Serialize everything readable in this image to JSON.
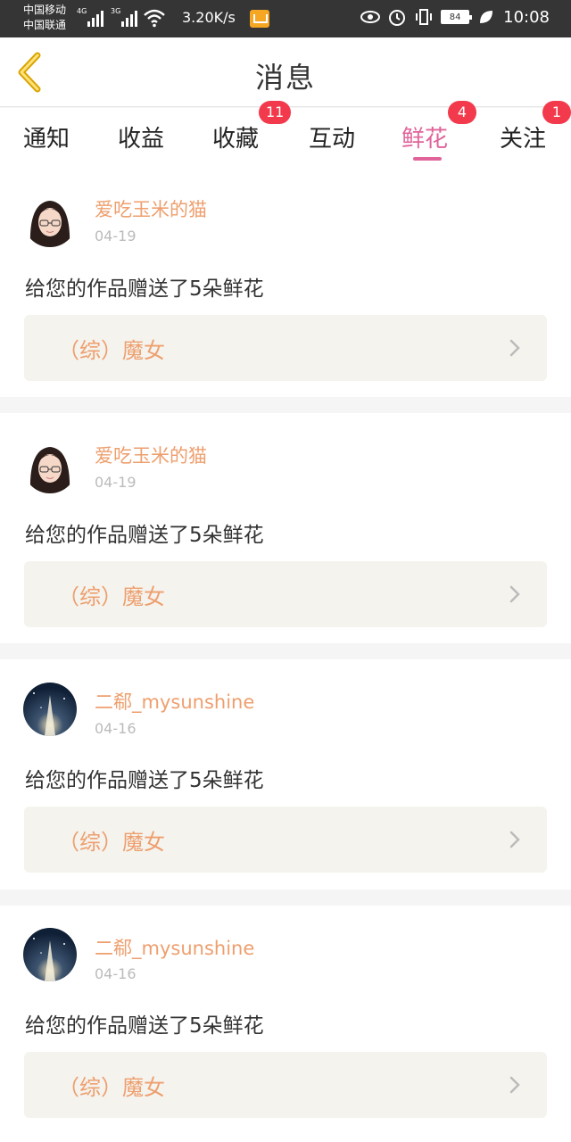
{
  "status_bar": {
    "carrier1": "中国移动",
    "carrier2": "中国联通",
    "net1": "4G",
    "net2": "3G",
    "speed": "3.20K/s",
    "battery": "84",
    "time": "10:08",
    "icons": [
      "signal-icon",
      "wifi-icon",
      "mail-icon",
      "eye-icon",
      "alarm-icon",
      "vibrate-icon",
      "battery-icon",
      "leaf-icon"
    ]
  },
  "header": {
    "title": "消息"
  },
  "tabs": [
    {
      "label": "通知",
      "badge": ""
    },
    {
      "label": "收益",
      "badge": ""
    },
    {
      "label": "收藏",
      "badge": "11"
    },
    {
      "label": "互动",
      "badge": ""
    },
    {
      "label": "鲜花",
      "badge": "4",
      "active": true
    },
    {
      "label": "关注",
      "badge": "1"
    }
  ],
  "colors": {
    "accent_pink": "#e0649a",
    "name_orange": "#ee9f6e",
    "badge_red": "#f23a4c",
    "card_bg": "#f4f3ee"
  },
  "feed": [
    {
      "user": "爱吃玉米的猫",
      "date": "04-19",
      "message": "给您的作品赠送了5朵鲜花",
      "work": "（综）魔女",
      "avatar": "girl-avatar"
    },
    {
      "user": "爱吃玉米的猫",
      "date": "04-19",
      "message": "给您的作品赠送了5朵鲜花",
      "work": "（综）魔女",
      "avatar": "girl-avatar"
    },
    {
      "user": "二郗_mysunshine",
      "date": "04-16",
      "message": "给您的作品赠送了5朵鲜花",
      "work": "（综）魔女",
      "avatar": "night-sky-avatar"
    },
    {
      "user": "二郗_mysunshine",
      "date": "04-16",
      "message": "给您的作品赠送了5朵鲜花",
      "work": "（综）魔女",
      "avatar": "night-sky-avatar"
    }
  ]
}
